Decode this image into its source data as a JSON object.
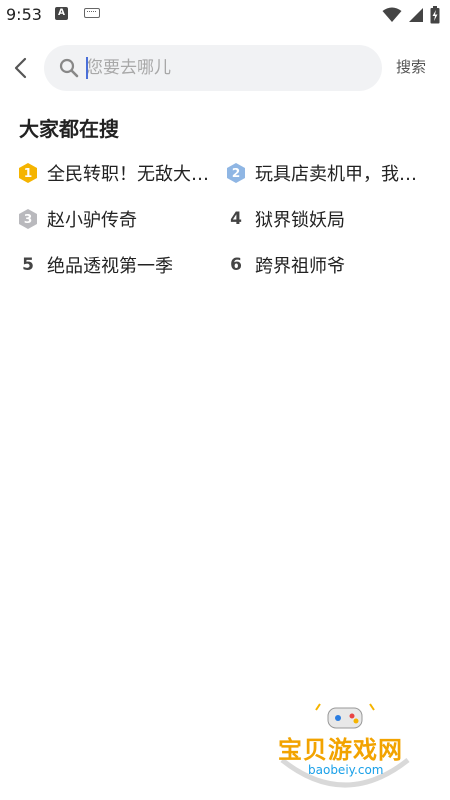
{
  "status_bar": {
    "time": "9:53",
    "icons": [
      "android-app-icon",
      "keyboard-icon",
      "wifi-icon",
      "signal-icon",
      "battery-charging-icon"
    ]
  },
  "search": {
    "back_icon": "chevron-left-icon",
    "placeholder": "您要去哪儿",
    "value": "",
    "search_icon": "search-icon",
    "submit_label": "搜索"
  },
  "hot": {
    "title": "大家都在搜",
    "items": [
      {
        "rank": "1",
        "label": "全民转职！无敌大…",
        "badge_color": "#f5b400"
      },
      {
        "rank": "2",
        "label": "玩具店卖机甲，我…",
        "badge_color": "#8fb6e4"
      },
      {
        "rank": "3",
        "label": "赵小驴传奇",
        "badge_color": "#b9b9bd"
      },
      {
        "rank": "4",
        "label": "狱界锁妖局"
      },
      {
        "rank": "5",
        "label": "绝品透视第一季"
      },
      {
        "rank": "6",
        "label": "跨界祖师爷"
      }
    ]
  },
  "watermark": {
    "name": "宝贝游戏网",
    "url": "baobeiy.com"
  }
}
